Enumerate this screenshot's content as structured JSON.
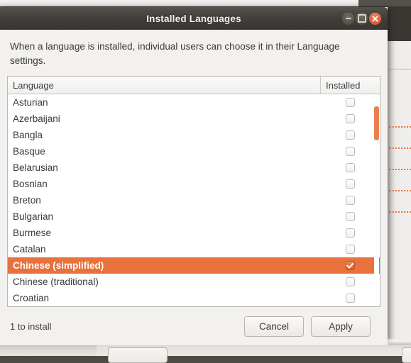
{
  "window": {
    "title": "Installed Languages",
    "buttons": {
      "minimize": "minimize",
      "maximize": "maximize",
      "close": "close"
    }
  },
  "description": "When a language is installed, individual users can choose it in their Language settings.",
  "table": {
    "columns": [
      "Language",
      "Installed"
    ],
    "rows": [
      {
        "language": "Asturian",
        "installed": false
      },
      {
        "language": "Azerbaijani",
        "installed": false
      },
      {
        "language": "Bangla",
        "installed": false
      },
      {
        "language": "Basque",
        "installed": false
      },
      {
        "language": "Belarusian",
        "installed": false
      },
      {
        "language": "Bosnian",
        "installed": false
      },
      {
        "language": "Breton",
        "installed": false
      },
      {
        "language": "Bulgarian",
        "installed": false
      },
      {
        "language": "Burmese",
        "installed": false
      },
      {
        "language": "Catalan",
        "installed": false
      },
      {
        "language": "Chinese (simplified)",
        "installed": true,
        "selected": true
      },
      {
        "language": "Chinese (traditional)",
        "installed": false
      },
      {
        "language": "Croatian",
        "installed": false
      }
    ]
  },
  "footer": {
    "status": "1 to install",
    "cancel_label": "Cancel",
    "apply_label": "Apply"
  },
  "colors": {
    "accent": "#e8713c",
    "titlebar": "#413e39",
    "dialog_bg": "#f2f1ef",
    "close_button": "#e2603a"
  }
}
